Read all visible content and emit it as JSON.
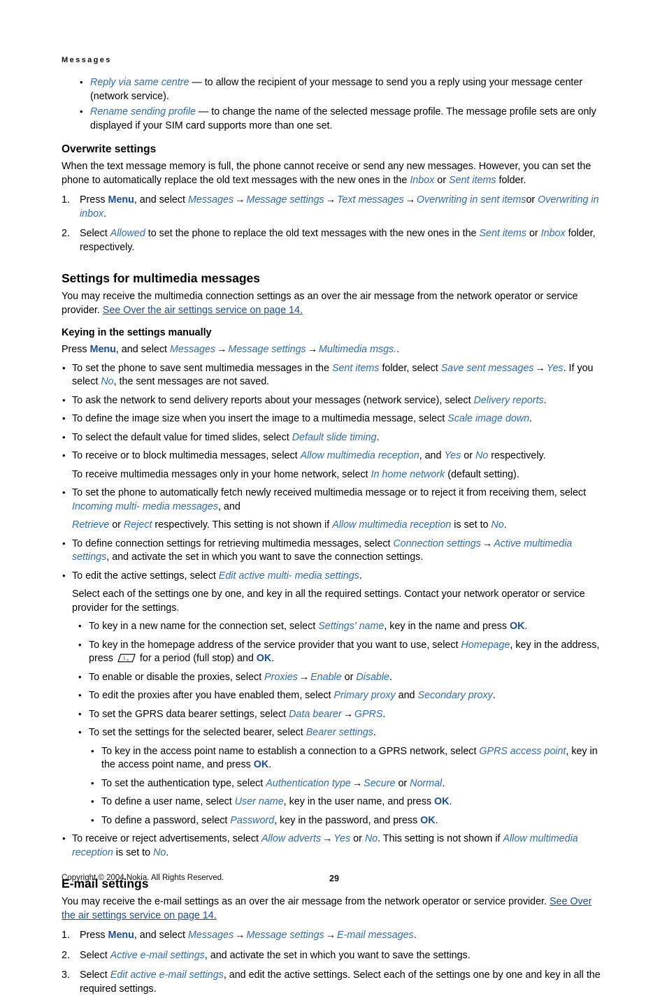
{
  "running_head": "Messages",
  "top_bullets": [
    {
      "term": "Reply via same centre",
      "text": " — to allow the recipient of your message to send you a reply using your message center (network service)."
    },
    {
      "term": "Rename sending profile",
      "text": " — to change the name of the selected message profile. The message profile sets are only displayed if your SIM card supports more than one set."
    }
  ],
  "overwrite": {
    "heading": "Overwrite settings",
    "intro_a": "When the text message memory is full, the phone cannot receive or send any new messages. However, you can set the phone to automatically replace the old text messages with the new ones in the ",
    "intro_inbox": "Inbox",
    "intro_or": " or ",
    "intro_sent": "Sent items",
    "intro_b": " folder.",
    "steps": [
      {
        "num": "1.",
        "pre": "Press ",
        "menu": "Menu",
        "mid": ", and select ",
        "path": [
          "Messages",
          "Message settings",
          "Text messages",
          "Overwriting in sent items"
        ],
        "tail_or": "or ",
        "tail_term": "Overwriting in inbox",
        "tail_end": "."
      },
      {
        "num": "2.",
        "pre": "Select ",
        "term": "Allowed",
        "mid": " to set the phone to replace the old text messages with the new ones in the ",
        "t2": "Sent items",
        "mid2": " or ",
        "t3": "Inbox",
        "end": " folder, respectively."
      }
    ]
  },
  "multimedia": {
    "heading": "Settings for multimedia messages",
    "intro": "You may receive the multimedia connection settings as an over the air message from the network operator or service provider. ",
    "intro_link": "See Over the air settings service on page 14.",
    "sub_heading": "Keying in the settings manually",
    "press_pre": "Press ",
    "press_menu": "Menu",
    "press_mid": ", and select ",
    "press_path": [
      "Messages",
      "Message settings",
      "Multimedia msgs."
    ],
    "press_end": ".",
    "bullets": [
      {
        "id": "save-sent",
        "parts": [
          {
            "t": "To set the phone to save sent multimedia messages in the ",
            "s": "plain"
          },
          {
            "t": "Sent items",
            "s": "ui"
          },
          {
            "t": " folder, select ",
            "s": "plain"
          },
          {
            "t": "Save sent messages",
            "s": "ui"
          },
          {
            "t": "arrow",
            "s": "arrow"
          },
          {
            "t": "Yes",
            "s": "ui"
          },
          {
            "t": ". If you select ",
            "s": "plain"
          },
          {
            "t": "No",
            "s": "ui"
          },
          {
            "t": ", the sent messages are not saved.",
            "s": "plain"
          }
        ]
      },
      {
        "id": "delivery-reports",
        "parts": [
          {
            "t": "To ask the network to send delivery reports about your messages (network service), select ",
            "s": "plain"
          },
          {
            "t": "Delivery reports",
            "s": "ui"
          },
          {
            "t": ".",
            "s": "plain"
          }
        ]
      },
      {
        "id": "scale-image",
        "parts": [
          {
            "t": "To define the image size when you insert the image to a multimedia message, select ",
            "s": "plain"
          },
          {
            "t": "Scale image down",
            "s": "ui"
          },
          {
            "t": ".",
            "s": "plain"
          }
        ]
      },
      {
        "id": "slide-timing",
        "parts": [
          {
            "t": "To select the default value for timed slides, select ",
            "s": "plain"
          },
          {
            "t": "Default slide timing",
            "s": "ui"
          },
          {
            "t": ".",
            "s": "plain"
          }
        ]
      },
      {
        "id": "allow-reception",
        "parts": [
          {
            "t": "To receive or to block multimedia messages, select ",
            "s": "plain"
          },
          {
            "t": "Allow multimedia reception",
            "s": "ui"
          },
          {
            "t": ", and ",
            "s": "plain"
          },
          {
            "t": "Yes",
            "s": "ui"
          },
          {
            "t": " or ",
            "s": "plain"
          },
          {
            "t": "No",
            "s": "ui"
          },
          {
            "t": " respectively.",
            "s": "plain"
          }
        ],
        "follow": [
          {
            "t": "To receive multimedia messages only in your home network, select ",
            "s": "plain"
          },
          {
            "t": "In home network",
            "s": "ui"
          },
          {
            "t": " (default setting).",
            "s": "plain"
          }
        ]
      },
      {
        "id": "incoming-multimedia",
        "parts": [
          {
            "t": "To set the phone to automatically fetch newly received multimedia message or to reject it from receiving them, select ",
            "s": "plain"
          },
          {
            "t": "Incoming multi- media messages",
            "s": "ui"
          },
          {
            "t": ", and",
            "s": "plain"
          }
        ],
        "follow": [
          {
            "t": "Retrieve",
            "s": "ui"
          },
          {
            "t": " or ",
            "s": "plain"
          },
          {
            "t": "Reject",
            "s": "ui"
          },
          {
            "t": " respectively. This setting is not shown if ",
            "s": "plain"
          },
          {
            "t": "Allow multimedia reception",
            "s": "ui"
          },
          {
            "t": " is set to ",
            "s": "plain"
          },
          {
            "t": "No",
            "s": "ui"
          },
          {
            "t": ".",
            "s": "plain"
          }
        ]
      },
      {
        "id": "connection-settings",
        "parts": [
          {
            "t": "To define connection settings for retrieving multimedia messages, select ",
            "s": "plain"
          },
          {
            "t": "Connection settings",
            "s": "ui"
          },
          {
            "t": "arrow",
            "s": "arrow"
          },
          {
            "t": "Active multimedia settings",
            "s": "ui"
          },
          {
            "t": ", and activate the set in which you want to save the connection settings.",
            "s": "plain"
          }
        ]
      },
      {
        "id": "edit-active-settings",
        "parts": [
          {
            "t": "To edit the active settings, select ",
            "s": "plain"
          },
          {
            "t": "Edit active multi- media settings",
            "s": "ui"
          },
          {
            "t": ".",
            "s": "plain"
          }
        ],
        "follow": [
          {
            "t": "Select each of the settings one by one, and key in all the required settings. Contact your network operator or service provider for the settings.",
            "s": "plain"
          }
        ]
      }
    ],
    "sub_bullets": [
      {
        "id": "settings-name",
        "parts": [
          {
            "t": "To key in a new name for the connection set, select ",
            "s": "plain"
          },
          {
            "t": "Settings' name",
            "s": "ui"
          },
          {
            "t": ", key in the name and press ",
            "s": "plain"
          },
          {
            "t": "OK",
            "s": "hard"
          },
          {
            "t": ".",
            "s": "plain"
          }
        ]
      },
      {
        "id": "homepage",
        "parts": [
          {
            "t": "To key in the homepage address of the service provider that you want to use, select ",
            "s": "plain"
          },
          {
            "t": "Homepage",
            "s": "ui"
          },
          {
            "t": ", key in the address, press ",
            "s": "plain"
          },
          {
            "t": "keyicon",
            "s": "icon"
          },
          {
            "t": " for a period (full stop) and ",
            "s": "plain"
          },
          {
            "t": "OK",
            "s": "hard"
          },
          {
            "t": ".",
            "s": "plain"
          }
        ]
      },
      {
        "id": "proxies",
        "parts": [
          {
            "t": "To enable or disable the proxies, select ",
            "s": "plain"
          },
          {
            "t": "Proxies",
            "s": "ui"
          },
          {
            "t": "arrow",
            "s": "arrow"
          },
          {
            "t": "Enable",
            "s": "ui"
          },
          {
            "t": " or ",
            "s": "plain"
          },
          {
            "t": "Disable",
            "s": "ui"
          },
          {
            "t": ".",
            "s": "plain"
          }
        ]
      },
      {
        "id": "edit-proxies",
        "parts": [
          {
            "t": "To edit the proxies after you have enabled them, select ",
            "s": "plain"
          },
          {
            "t": "Primary proxy",
            "s": "ui"
          },
          {
            "t": " and ",
            "s": "plain"
          },
          {
            "t": "Secondary proxy",
            "s": "ui"
          },
          {
            "t": ".",
            "s": "plain"
          }
        ]
      },
      {
        "id": "data-bearer",
        "parts": [
          {
            "t": "To set the GPRS data bearer settings, select ",
            "s": "plain"
          },
          {
            "t": "Data bearer",
            "s": "ui"
          },
          {
            "t": "arrow",
            "s": "arrow"
          },
          {
            "t": "GPRS",
            "s": "ui"
          },
          {
            "t": ".",
            "s": "plain"
          }
        ]
      },
      {
        "id": "bearer-settings",
        "parts": [
          {
            "t": "To set the settings for the selected bearer, select ",
            "s": "plain"
          },
          {
            "t": "Bearer settings",
            "s": "ui"
          },
          {
            "t": ".",
            "s": "plain"
          }
        ]
      }
    ],
    "sub_sub_bullets": [
      {
        "id": "gprs-access-point",
        "parts": [
          {
            "t": "To key in the access point name to establish a connection to a GPRS network, select ",
            "s": "plain"
          },
          {
            "t": "GPRS access point",
            "s": "ui"
          },
          {
            "t": ", key in the access point name, and press ",
            "s": "plain"
          },
          {
            "t": "OK",
            "s": "hard"
          },
          {
            "t": ".",
            "s": "plain"
          }
        ]
      },
      {
        "id": "authentication-type",
        "parts": [
          {
            "t": "To set the authentication type, select ",
            "s": "plain"
          },
          {
            "t": "Authentication type",
            "s": "ui"
          },
          {
            "t": "arrow",
            "s": "arrow"
          },
          {
            "t": "Secure",
            "s": "ui"
          },
          {
            "t": " or ",
            "s": "plain"
          },
          {
            "t": "Normal",
            "s": "ui"
          },
          {
            "t": ".",
            "s": "plain"
          }
        ]
      },
      {
        "id": "user-name",
        "parts": [
          {
            "t": "To define a user name, select ",
            "s": "plain"
          },
          {
            "t": "User name",
            "s": "ui"
          },
          {
            "t": ", key in the user name, and press ",
            "s": "plain"
          },
          {
            "t": "OK",
            "s": "hard"
          },
          {
            "t": ".",
            "s": "plain"
          }
        ]
      },
      {
        "id": "password",
        "parts": [
          {
            "t": "To define a password, select ",
            "s": "plain"
          },
          {
            "t": "Password",
            "s": "ui"
          },
          {
            "t": ", key in the password, and press ",
            "s": "plain"
          },
          {
            "t": "OK",
            "s": "hard"
          },
          {
            "t": ".",
            "s": "plain"
          }
        ]
      }
    ],
    "last_bullet": {
      "id": "allow-adverts",
      "parts": [
        {
          "t": "To receive or reject advertisements, select ",
          "s": "plain"
        },
        {
          "t": "Allow adverts",
          "s": "ui"
        },
        {
          "t": "arrow",
          "s": "arrow"
        },
        {
          "t": "Yes",
          "s": "ui"
        },
        {
          "t": " or ",
          "s": "plain"
        },
        {
          "t": "No",
          "s": "ui"
        },
        {
          "t": ". This setting is not shown if ",
          "s": "plain"
        },
        {
          "t": "Allow multimedia reception",
          "s": "ui"
        },
        {
          "t": " is set to ",
          "s": "plain"
        },
        {
          "t": "No",
          "s": "ui"
        },
        {
          "t": ".",
          "s": "plain"
        }
      ]
    }
  },
  "email": {
    "heading": "E-mail settings",
    "intro": "You may receive the e-mail settings as an over the air message from the network operator or service provider. ",
    "intro_link": "See Over the air settings service on page 14.",
    "steps": [
      {
        "num": "1.",
        "parts": [
          {
            "t": "Press ",
            "s": "plain"
          },
          {
            "t": "Menu",
            "s": "hard"
          },
          {
            "t": ", and select ",
            "s": "plain"
          },
          {
            "t": "Messages",
            "s": "ui"
          },
          {
            "t": "arrow",
            "s": "arrow"
          },
          {
            "t": "Message settings",
            "s": "ui"
          },
          {
            "t": "arrow",
            "s": "arrow"
          },
          {
            "t": "E-mail messages",
            "s": "ui"
          },
          {
            "t": ".",
            "s": "plain"
          }
        ]
      },
      {
        "num": "2.",
        "parts": [
          {
            "t": "Select ",
            "s": "plain"
          },
          {
            "t": "Active e-mail settings",
            "s": "ui"
          },
          {
            "t": ", and activate the set in which you want to save the settings.",
            "s": "plain"
          }
        ]
      },
      {
        "num": "3.",
        "parts": [
          {
            "t": "Select ",
            "s": "plain"
          },
          {
            "t": "Edit active e-mail settings",
            "s": "ui"
          },
          {
            "t": ", and edit the active settings. Select each of the settings one by one and key in all the required settings.",
            "s": "plain"
          }
        ]
      }
    ]
  },
  "footer": {
    "copyright": "Copyright © 2004 Nokia. All Rights Reserved.",
    "page_number": "29"
  },
  "colors": {
    "ui_term": "#2E6DB4",
    "hard_key": "#1B4EA0",
    "xref_link": "#1B4EA0",
    "text": "#000000"
  },
  "icons": {
    "arrow_glyph": "→",
    "bullet_glyph": "•",
    "key_one_icon": "phone-key-1"
  }
}
